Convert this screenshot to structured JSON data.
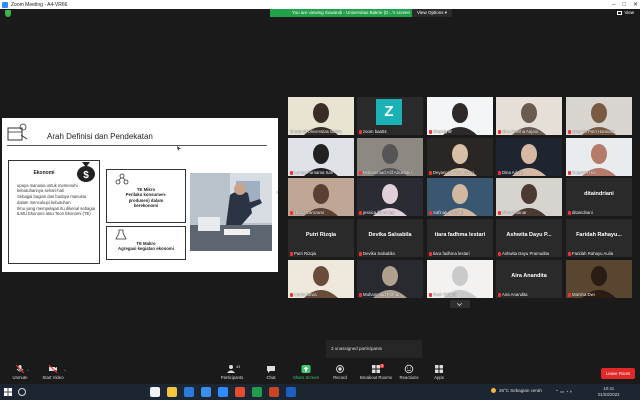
{
  "window": {
    "title": "Zoom Meeting - A4-VR66"
  },
  "topbar": {
    "banner": "You are viewing Suwandi - Universitas Bakrie (D...'s screen",
    "view_options": "View Options ▾",
    "view_label": "View"
  },
  "slide": {
    "title": "Arah Definisi dan Pendekatan",
    "box_economy_title": "Ekonomi",
    "box_economy_bullets": [
      "upaya manusia untuk memenuhi kebutuhannya sehari-hari",
      "Sebagai bagian dan budaya manusia dalam mencukupi kebutuhan",
      "Ilmu yang mempelajari itu dikenal sebagai ILMU Ekonomi atau Teori Ekonomi (TE)"
    ],
    "box_micro": "TE Mikro\nPerilaku  konsumen-\nprodusen)  dalam\nberekonomi",
    "box_macro": "TE Makro\nAgregasi kegiatan ekonomi"
  },
  "gallery": {
    "tiles": [
      {
        "name": "Suwandi Universitas Bakrie",
        "active": true,
        "mic_off": false
      },
      {
        "name": "zoom baa04",
        "initial": "Z",
        "mic_off": true
      },
      {
        "name": "Khaeriyah",
        "mic_off": true
      },
      {
        "name": "Vira Marsha Anjani",
        "mic_off": true
      },
      {
        "name": "Ananda Putri Hamidah",
        "mic_off": true
      },
      {
        "name": "Lenny Purnama Sari",
        "mic_off": true
      },
      {
        "name": "Muhammad Afif Abukhairi",
        "mic_off": true
      },
      {
        "name": "Deyannisa Wulandari",
        "mic_off": true
      },
      {
        "name": "Dina Adelia",
        "mic_off": true
      },
      {
        "name": "Eugenia Hia",
        "mic_off": true
      },
      {
        "name": "Hafaz Zamzami",
        "mic_off": true
      },
      {
        "name": "jessica florentina",
        "mic_off": true
      },
      {
        "name": "Safinatun Najah",
        "mic_off": true
      },
      {
        "name": "Afnan Manar",
        "mic_off": true
      },
      {
        "name": "ditaindriani",
        "big": "ditaindriani",
        "mic_off": true
      },
      {
        "name": "Putri Rizqia",
        "big": "Putri Rizqia",
        "mic_off": true
      },
      {
        "name": "Devika Salsabila",
        "big": "Devika Salsabila",
        "mic_off": true
      },
      {
        "name": "tiara fadhma lestari",
        "big": "tiara fadhma lestari",
        "mic_off": true
      },
      {
        "name": "Ashwita Dayu Pramudita",
        "big": "Ashwita Dayu P...",
        "mic_off": true
      },
      {
        "name": "Faridah Rahayu Aulia",
        "big": "Faridah Rahayu...",
        "mic_off": true
      },
      {
        "name": "Linda Novia",
        "mic_off": true
      },
      {
        "name": "Muhammad Farhan",
        "mic_off": true
      },
      {
        "name": "Reni Yulianti",
        "mic_off": true
      },
      {
        "name": "Aira Anandita",
        "big": "Aira Anandita",
        "mic_off": true
      },
      {
        "name": "Marsha Dwi",
        "mic_off": true
      }
    ]
  },
  "unassigned": "3 unassigned participants",
  "toolbar": {
    "unmute": "Unmute",
    "start_video": "Start Video",
    "participants": "Participants",
    "participants_count": "43",
    "chat": "Chat",
    "share_screen": "Share Screen",
    "record": "Record",
    "breakout": "Breakout Rooms",
    "breakout_badge": "3",
    "reactions": "Reactions",
    "apps": "Apps",
    "leave": "Leave Room"
  },
  "taskbar": {
    "weather": "26°C  Sebagian cerah",
    "time": "10:41",
    "date": "01/03/2022"
  },
  "colors": {
    "accent_green": "#23a04a",
    "leave_red": "#e02828",
    "zoom_blue": "#2d8cff",
    "active_outline": "#c9d832"
  }
}
